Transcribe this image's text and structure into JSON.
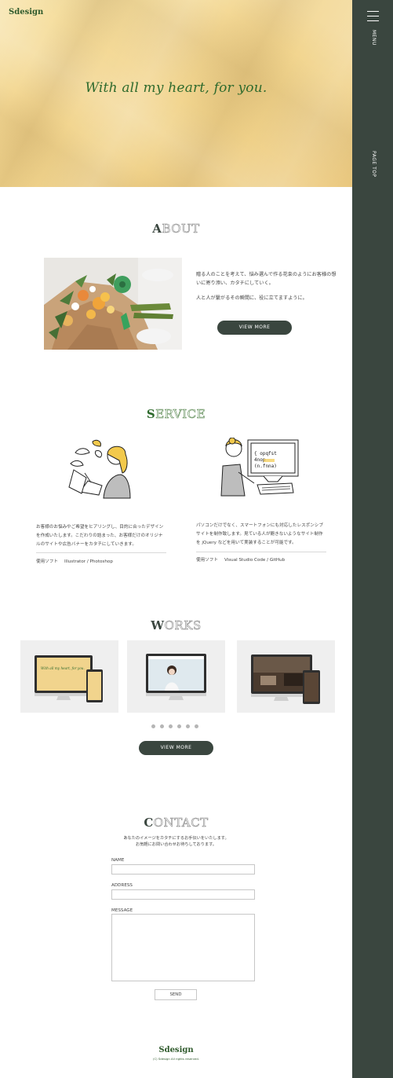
{
  "brand": {
    "logo": "Sdesign",
    "tagline": "With all my heart, for you."
  },
  "sidebar": {
    "menu_label": "MENU",
    "pagetop_label": "PAGE TOP"
  },
  "sections": {
    "about": {
      "first": "A",
      "rest": "BOUT"
    },
    "service": {
      "first": "S",
      "rest": "ERVICE"
    },
    "works": {
      "first": "W",
      "rest": "ORKS"
    },
    "contact": {
      "first": "C",
      "rest": "ONTACT"
    }
  },
  "about": {
    "paragraph1": "贈る人のことを考えて、悩み選んで作る花束のようにお客様の想いに寄り添い、カタチにしていく。",
    "paragraph2": "人と人が繋がるその瞬間に、役に立てますように。",
    "view_more": "VIEW MORE"
  },
  "service": {
    "items": [
      {
        "description": "お客様のお悩みやご希望をヒアリングし、目的に合ったデザインを作成いたします。こだわりの詰まった、お客様だけのオリジナルのサイトや広告バナーをカタチにしていきます。",
        "software_label": "使用ソフト",
        "software": "Illustrator / Photoshop"
      },
      {
        "description": "パソコンだけでなく、スマートフォンにも対応したレスポンシブサイトを制作致します。見ている人が飽きないようなサイト制作を jQuery などを用いて実装することが可能です。",
        "software_label": "使用ソフト",
        "software": "Visual Studio Code / GitHub"
      }
    ],
    "screen_code": [
      "{ opqfst",
      "  4nop",
      "  (n.fnna)"
    ]
  },
  "works": {
    "card1_tagline": "With all my heart, for you.",
    "view_more": "VIEW MORE",
    "dots": 6
  },
  "contact": {
    "intro_line1": "あなたのイメージをカタチにするお手伝いをいたします。",
    "intro_line2": "お気軽にお問い合わせお待ちしております。",
    "fields": {
      "name": "NAME",
      "address": "ADDRESS",
      "message": "MESSAGE"
    },
    "send": "SEND"
  },
  "footer": {
    "logo": "Sdesign",
    "copyright": "(C) Sdesign All rights reserved."
  }
}
